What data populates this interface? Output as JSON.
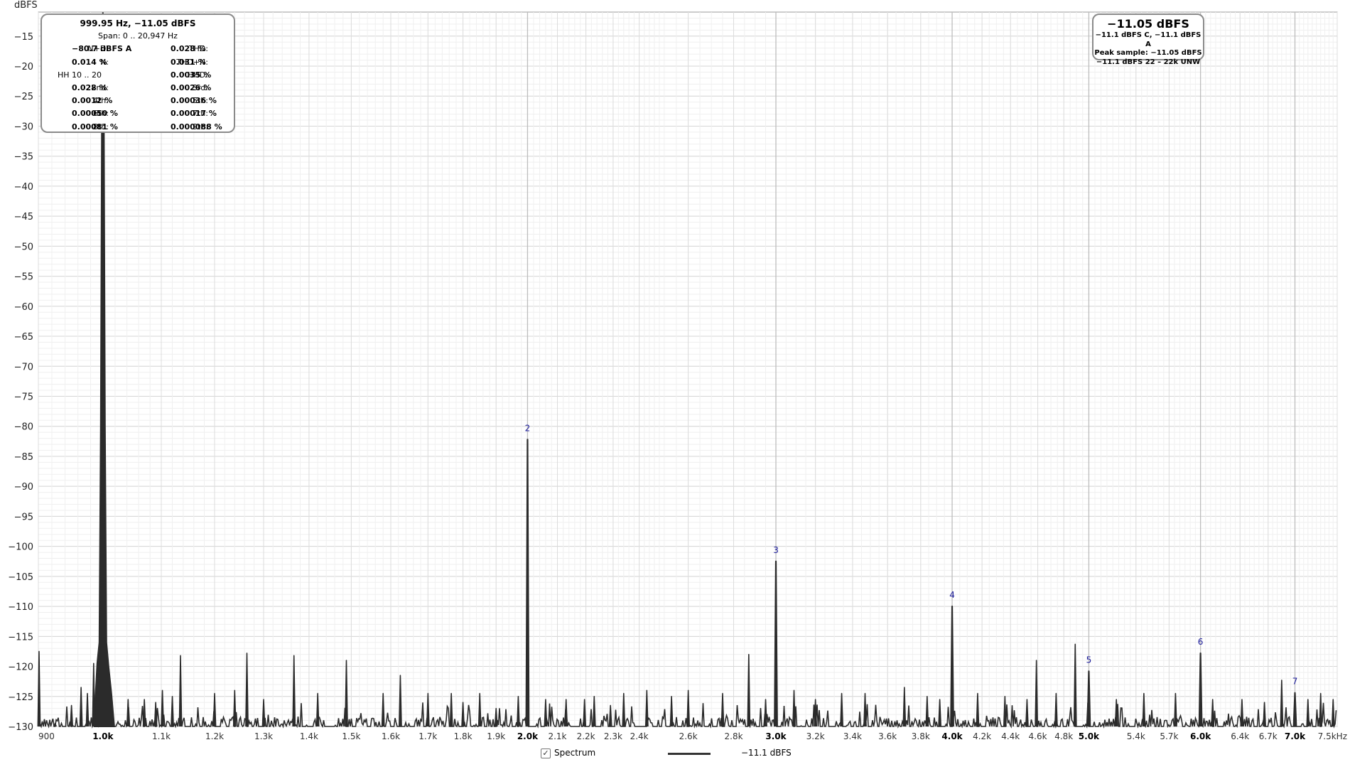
{
  "chart_data": {
    "type": "line",
    "title": "",
    "ylabel": "dBFS",
    "xlabel": "",
    "x_scale": "log",
    "xlim": [
      900,
      7500
    ],
    "ylim": [
      -130,
      -11
    ],
    "grid": true,
    "y_ticks": [
      -15,
      -20,
      -25,
      -30,
      -35,
      -40,
      -45,
      -50,
      -55,
      -60,
      -65,
      -70,
      -75,
      -80,
      -85,
      -90,
      -95,
      -100,
      -105,
      -110,
      -115,
      -120,
      -125,
      -130
    ],
    "x_ticks": [
      {
        "value": 900,
        "label": "900",
        "major": false
      },
      {
        "value": 1000,
        "label": "1.0k",
        "major": true
      },
      {
        "value": 1100,
        "label": "1.1k",
        "major": false
      },
      {
        "value": 1200,
        "label": "1.2k",
        "major": false
      },
      {
        "value": 1300,
        "label": "1.3k",
        "major": false
      },
      {
        "value": 1400,
        "label": "1.4k",
        "major": false
      },
      {
        "value": 1500,
        "label": "1.5k",
        "major": false
      },
      {
        "value": 1600,
        "label": "1.6k",
        "major": false
      },
      {
        "value": 1700,
        "label": "1.7k",
        "major": false
      },
      {
        "value": 1800,
        "label": "1.8k",
        "major": false
      },
      {
        "value": 1900,
        "label": "1.9k",
        "major": false
      },
      {
        "value": 2000,
        "label": "2.0k",
        "major": true
      },
      {
        "value": 2100,
        "label": "2.1k",
        "major": false
      },
      {
        "value": 2200,
        "label": "2.2k",
        "major": false
      },
      {
        "value": 2300,
        "label": "2.3k",
        "major": false
      },
      {
        "value": 2400,
        "label": "2.4k",
        "major": false
      },
      {
        "value": 2600,
        "label": "2.6k",
        "major": false
      },
      {
        "value": 2800,
        "label": "2.8k",
        "major": false
      },
      {
        "value": 3000,
        "label": "3.0k",
        "major": true
      },
      {
        "value": 3200,
        "label": "3.2k",
        "major": false
      },
      {
        "value": 3400,
        "label": "3.4k",
        "major": false
      },
      {
        "value": 3600,
        "label": "3.6k",
        "major": false
      },
      {
        "value": 3800,
        "label": "3.8k",
        "major": false
      },
      {
        "value": 4000,
        "label": "4.0k",
        "major": true
      },
      {
        "value": 4200,
        "label": "4.2k",
        "major": false
      },
      {
        "value": 4400,
        "label": "4.4k",
        "major": false
      },
      {
        "value": 4600,
        "label": "4.6k",
        "major": false
      },
      {
        "value": 4800,
        "label": "4.8k",
        "major": false
      },
      {
        "value": 5000,
        "label": "5.0k",
        "major": true
      },
      {
        "value": 5400,
        "label": "5.4k",
        "major": false
      },
      {
        "value": 5700,
        "label": "5.7k",
        "major": false
      },
      {
        "value": 6000,
        "label": "6.0k",
        "major": true
      },
      {
        "value": 6400,
        "label": "6.4k",
        "major": false
      },
      {
        "value": 6700,
        "label": "6.7k",
        "major": false
      },
      {
        "value": 7000,
        "label": "7.0k",
        "major": true
      },
      {
        "value": 7500,
        "label": "7.5kHz",
        "major": false
      }
    ],
    "fundamental": {
      "freq": 999.95,
      "level": -11.05
    },
    "noise_floor": -130,
    "harmonics": [
      {
        "label": "2",
        "freq": 2000,
        "level": -82.2
      },
      {
        "label": "3",
        "freq": 3000,
        "level": -102.5
      },
      {
        "label": "4",
        "freq": 4000,
        "level": -110
      },
      {
        "label": "5",
        "freq": 5000,
        "level": -120.8
      },
      {
        "label": "6",
        "freq": 6000,
        "level": -117.8
      },
      {
        "label": "7",
        "freq": 7000,
        "level": -124.4
      }
    ],
    "spurs": [
      {
        "freq": 901,
        "level": -117.5
      },
      {
        "freq": 925,
        "level": -129.5
      },
      {
        "freq": 950,
        "level": -126.5
      },
      {
        "freq": 965,
        "level": -123.5
      },
      {
        "freq": 975,
        "level": -124.5
      },
      {
        "freq": 985,
        "level": -119.5
      },
      {
        "freq": 1015,
        "level": -125.5
      },
      {
        "freq": 1042,
        "level": -125.5
      },
      {
        "freq": 1070,
        "level": -125.5
      },
      {
        "freq": 1090,
        "level": -126
      },
      {
        "freq": 1102,
        "level": -124
      },
      {
        "freq": 1120,
        "level": -125
      },
      {
        "freq": 1135,
        "level": -118.2
      },
      {
        "freq": 1200,
        "level": -124.5
      },
      {
        "freq": 1240,
        "level": -124
      },
      {
        "freq": 1265,
        "level": -117.8
      },
      {
        "freq": 1300,
        "level": -125.5
      },
      {
        "freq": 1366,
        "level": -118.2
      },
      {
        "freq": 1420,
        "level": -124.5
      },
      {
        "freq": 1488,
        "level": -119
      },
      {
        "freq": 1580,
        "level": -124.5
      },
      {
        "freq": 1625,
        "level": -121.5
      },
      {
        "freq": 1700,
        "level": -124.5
      },
      {
        "freq": 1766,
        "level": -124.5
      },
      {
        "freq": 1800,
        "level": -126
      },
      {
        "freq": 1850,
        "level": -124.5
      },
      {
        "freq": 1900,
        "level": -127
      },
      {
        "freq": 1970,
        "level": -125
      },
      {
        "freq": 2060,
        "level": -125.5
      },
      {
        "freq": 2130,
        "level": -125.5
      },
      {
        "freq": 2195,
        "level": -125.5
      },
      {
        "freq": 2230,
        "level": -125
      },
      {
        "freq": 2290,
        "level": -126.5
      },
      {
        "freq": 2340,
        "level": -124.5
      },
      {
        "freq": 2430,
        "level": -124
      },
      {
        "freq": 2530,
        "level": -125
      },
      {
        "freq": 2600,
        "level": -124
      },
      {
        "freq": 2750,
        "level": -124.5
      },
      {
        "freq": 2870,
        "level": -118
      },
      {
        "freq": 2950,
        "level": -125.5
      },
      {
        "freq": 3090,
        "level": -124
      },
      {
        "freq": 3200,
        "level": -125.5
      },
      {
        "freq": 3340,
        "level": -124.5
      },
      {
        "freq": 3470,
        "level": -124.5
      },
      {
        "freq": 3700,
        "level": -123.5
      },
      {
        "freq": 3840,
        "level": -125
      },
      {
        "freq": 3920,
        "level": -125.5
      },
      {
        "freq": 4170,
        "level": -124.5
      },
      {
        "freq": 4360,
        "level": -125
      },
      {
        "freq": 4520,
        "level": -125.5
      },
      {
        "freq": 4590,
        "level": -119
      },
      {
        "freq": 4740,
        "level": -124.5
      },
      {
        "freq": 4890,
        "level": -116.3
      },
      {
        "freq": 5230,
        "level": -125.5
      },
      {
        "freq": 5470,
        "level": -124.5
      },
      {
        "freq": 5760,
        "level": -124.5
      },
      {
        "freq": 6120,
        "level": -125.5
      },
      {
        "freq": 6420,
        "level": -125.5
      },
      {
        "freq": 6660,
        "level": -126
      },
      {
        "freq": 6850,
        "level": -122.3
      },
      {
        "freq": 7150,
        "level": -125.5
      },
      {
        "freq": 7300,
        "level": -124.5
      },
      {
        "freq": 7450,
        "level": -125.5
      }
    ]
  },
  "stats": {
    "title": "999.95 Hz, −11.05 dBFS",
    "span": "Span: 0 .. 20,947 Hz",
    "rows": [
      {
        "l1": "N+D:",
        "v1": "−80.7 dBFS A",
        "l2": "THD:",
        "v2": "0.028 %"
      },
      {
        "l1": "N:",
        "v1": "0.014 %",
        "l2": "THD+N:",
        "v2": "0.031 %"
      },
      {
        "l1": "HH 10 .. 20",
        "v1": "",
        "l2": "HHD:",
        "v2": "0.0035 %"
      },
      {
        "l1": "2nd:",
        "v1": "0.028 %",
        "l2": "3rd:",
        "v2": "0.0026 %"
      },
      {
        "l1": "4th:",
        "v1": "0.0012 %",
        "l2": "5th:",
        "v2": "0.00036 %"
      },
      {
        "l1": "6th:",
        "v1": "0.00050 %",
        "l2": "7th:",
        "v2": "0.00017 %"
      },
      {
        "l1": "8th:",
        "v1": "0.00081 %",
        "l2": "9th:",
        "v2": "0.000088 %"
      }
    ]
  },
  "level": {
    "big": "−11.05 dBFS",
    "line1": "−11.1 dBFS C, −11.1 dBFS A",
    "line2": "Peak sample: −11.05 dBFS",
    "line3": "−11.1 dBFS 22 – 22k UNW"
  },
  "legend": {
    "checkbox_mark": "✓",
    "checkbox_label": "Spectrum",
    "series_label": "−11.1 dBFS"
  },
  "colors": {
    "trace": "#2b2b2b",
    "grid_minor": "#eeeeee",
    "grid_major": "#cccccc",
    "harmonic_label": "#1a1a9a"
  }
}
